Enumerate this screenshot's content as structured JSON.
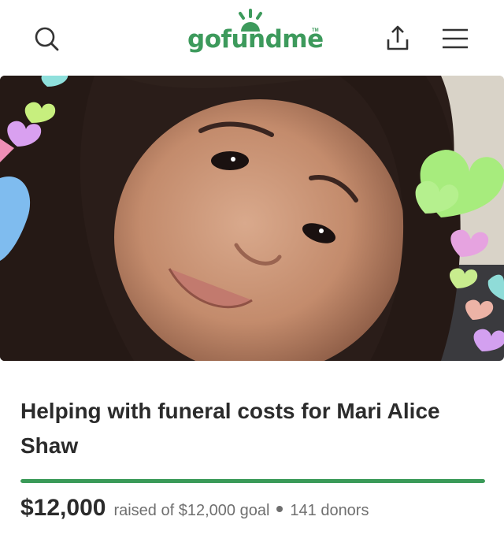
{
  "header": {
    "logo_text": "gofundme",
    "logo_tm": "TM",
    "icons": {
      "search": "search-icon",
      "share": "share-icon",
      "menu": "hamburger-menu-icon"
    }
  },
  "campaign": {
    "image_alt": "",
    "title": "Helping with funeral costs for Mari Alice Shaw",
    "raised_amount": "$12,000",
    "raised_text": "raised of $12,000 goal",
    "donors_text": "141 donors",
    "progress_fraction": 1.0
  },
  "colors": {
    "brand_green": "#3d9a5c",
    "progress_green": "#3a9a58",
    "text_dark": "#2b2b2b",
    "text_muted": "#6f6f6f"
  }
}
